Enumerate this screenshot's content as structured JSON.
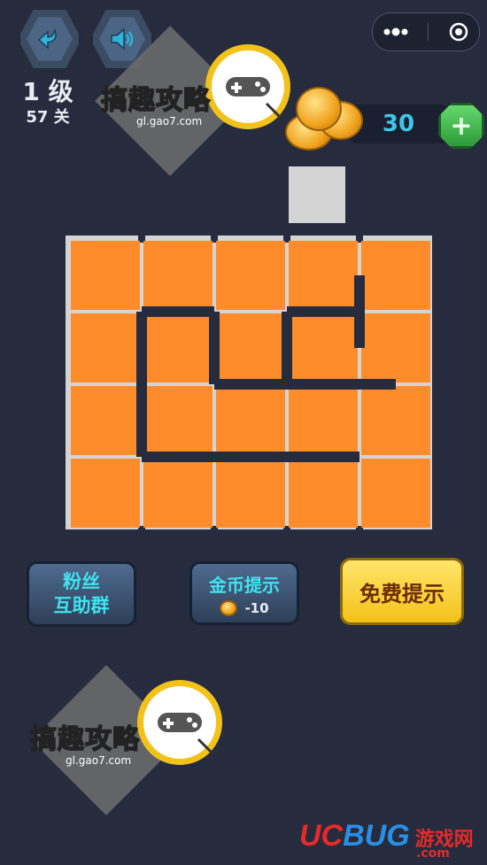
{
  "level": {
    "grade": "1 级",
    "stage": "57 关"
  },
  "coins": {
    "count": "30"
  },
  "buttons": {
    "fans_group": [
      "粉丝",
      "互助群"
    ],
    "coin_hint": {
      "label": "金币提示",
      "cost": "-10"
    },
    "free_hint": "免费提示"
  },
  "watermark": {
    "title": "搞趣攻略",
    "url": "gl.gao7.com"
  },
  "footer": {
    "brand_uc": "UC",
    "brand_bug": "BUG",
    "brand_cn": "游戏网",
    "brand_com": ".com"
  },
  "icons": [
    "back-arrow-icon",
    "speaker-icon",
    "more-dots-icon",
    "close-target-icon",
    "coin-stack-icon",
    "plus-icon",
    "gamepad-icon"
  ],
  "colors": {
    "background": "#262b3d",
    "path": "#ff8c2a",
    "grid_cell": "#d4d4d4",
    "accent_cyan": "#3fe3f0",
    "accent_yellow": "#f3c218"
  }
}
